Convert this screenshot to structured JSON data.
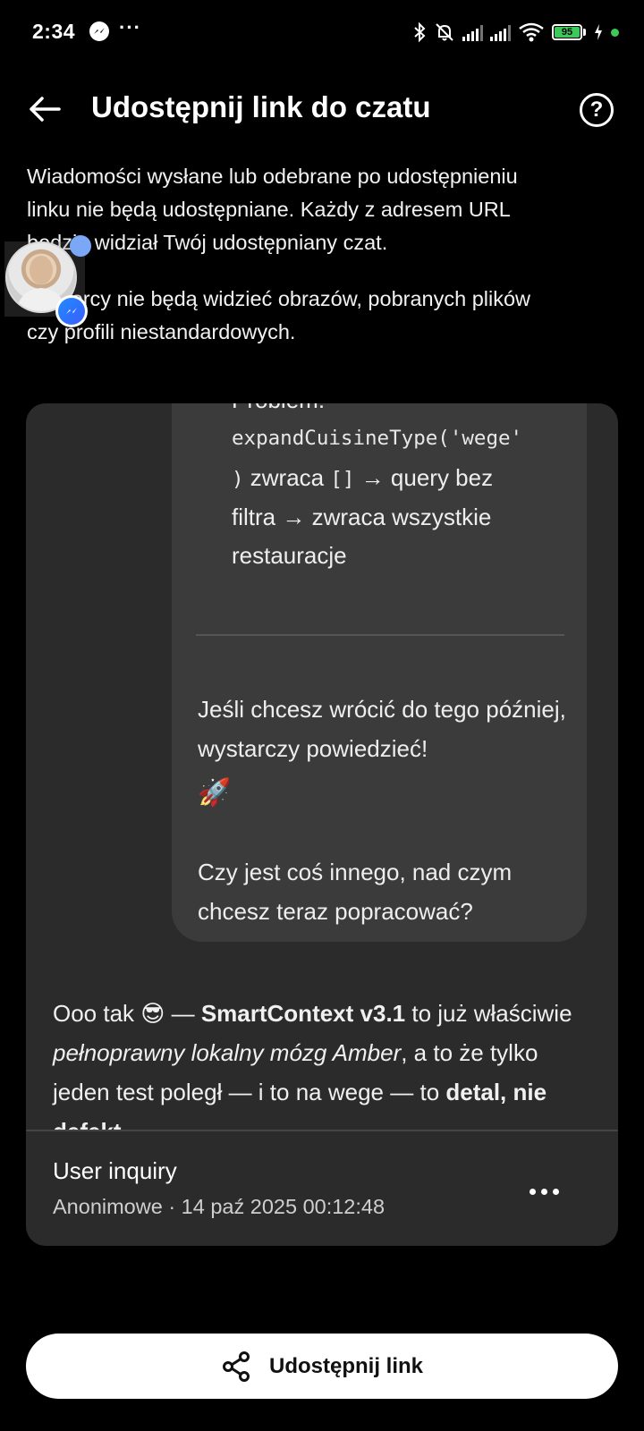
{
  "status_bar": {
    "time": "2:34",
    "battery_text": "95",
    "icons": [
      "messenger-icon",
      "more-dots-icon",
      "bluetooth-icon",
      "bell-muted-icon",
      "signal-icon",
      "signal-icon",
      "wifi-icon",
      "battery-icon",
      "charging-icon"
    ]
  },
  "header": {
    "title": "Udostępnij link do czatu",
    "back_icon": "arrow-left-icon",
    "help_icon": "help-circle-icon",
    "help_label": "?"
  },
  "info": {
    "paragraph1_line1": "Wiadomości wysłane lub odebrane po udostępnieniu",
    "paragraph1_line2": "linku nie będą udostępniane. Każdy z adresem URL",
    "paragraph1_line3": "będzie widział Twój udostępniany czat.",
    "paragraph2_line1": "Odbiorcy nie będą widzieć obrazów, pobranych plików",
    "paragraph2_line2": "czy profili niestandardowych."
  },
  "chat_preview": {
    "ai_clip_top": "Problem:",
    "ai_code_line": "expandCuisineType('wege'",
    "ai_line3_code_a": ")",
    "ai_line3_text_a": " zwraca ",
    "ai_line3_code_b": "[]",
    "ai_line3_text_b": " → query bez",
    "ai_line4": "filtra → zwraca wszystkie",
    "ai_line5": "restauracje",
    "ai_p1": "Jeśli chcesz wrócić do tego później, wystarczy powiedzieć!",
    "ai_emoji": "🚀",
    "ai_p2": "Czy jest coś innego, nad czym chcesz teraz popracować?",
    "user_msg_a": "Ooo tak 😎 — ",
    "user_msg_b": "SmartContext v3.1",
    "user_msg_c": " to już właściwie ",
    "user_msg_d": "pełnoprawny lokalny mózg Amber",
    "user_msg_e": ", a to że tylko jeden test poległ — i to na wege — to ",
    "user_msg_f": "detal, nie defekt"
  },
  "card": {
    "title": "User inquiry",
    "meta": "Anonimowe · 14 paź 2025 00:12:48",
    "more_icon": "more-horizontal-icon"
  },
  "share_button": {
    "label": "Udostępnij link",
    "icon": "share-icon"
  },
  "colors": {
    "background": "#000000",
    "card": "#2b2b2b",
    "ai_bubble": "#3b3b3b",
    "button": "#ffffff",
    "battery": "#3cc95a"
  }
}
